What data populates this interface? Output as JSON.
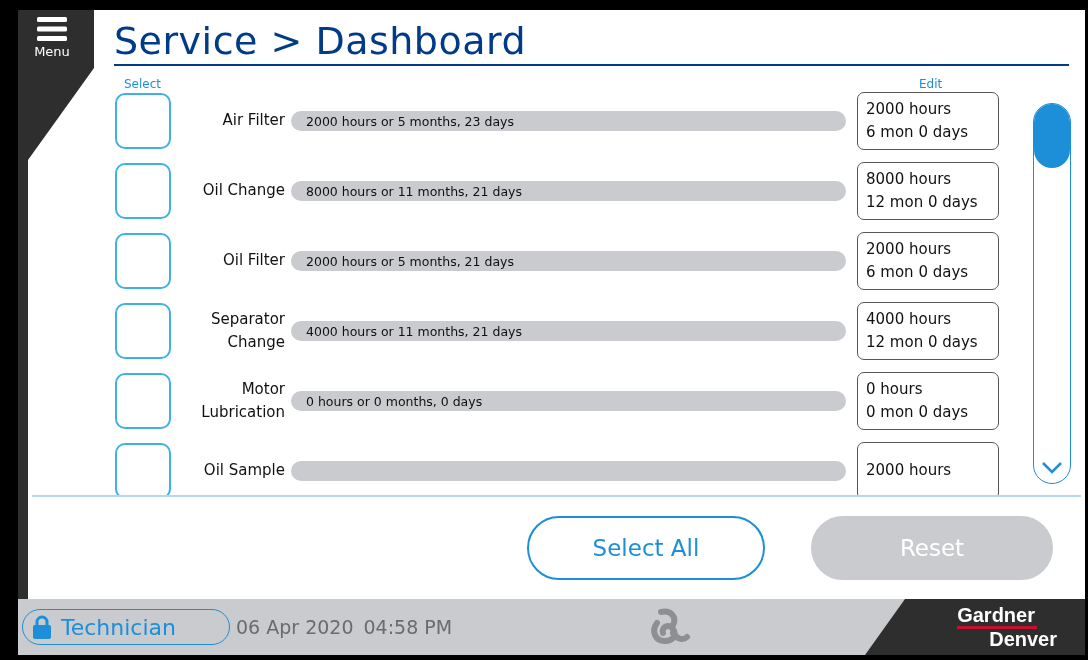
{
  "header": {
    "menu_label": "Menu",
    "title": "Service > Dashboard"
  },
  "columns": {
    "select": "Select",
    "edit": "Edit"
  },
  "tasks": [
    {
      "label": "Air Filter",
      "checked": false,
      "interval": "2000 hours or 5 months, 23 days",
      "edit": [
        "2000 hours",
        "6 mon 0 days"
      ]
    },
    {
      "label": "Oil Change",
      "checked": false,
      "interval": "8000 hours or 11 months, 21 days",
      "edit": [
        "8000 hours",
        "12 mon 0 days"
      ]
    },
    {
      "label": "Oil Filter",
      "checked": false,
      "interval": "2000 hours or 5 months, 21 days",
      "edit": [
        "2000 hours",
        "6 mon 0 days"
      ]
    },
    {
      "label": "Separator Change",
      "checked": false,
      "interval": "4000 hours or 11 months, 21 days",
      "edit": [
        "4000 hours",
        "12 mon 0 days"
      ]
    },
    {
      "label": "Motor Lubrication",
      "checked": false,
      "interval": "0 hours or 0 months, 0 days",
      "edit": [
        "0 hours",
        "0 mon 0 days"
      ]
    },
    {
      "label": "Oil Sample",
      "checked": false,
      "edit": [
        "2000 hours"
      ]
    }
  ],
  "buttons": [
    {
      "label": "Select All",
      "disabled": false
    },
    {
      "label": "Reset",
      "disabled": true
    }
  ],
  "footer": {
    "user": "Technician",
    "date": "06 Apr 2020",
    "time": "04:58 PM",
    "brand": [
      "Gardner",
      "Denver"
    ]
  }
}
